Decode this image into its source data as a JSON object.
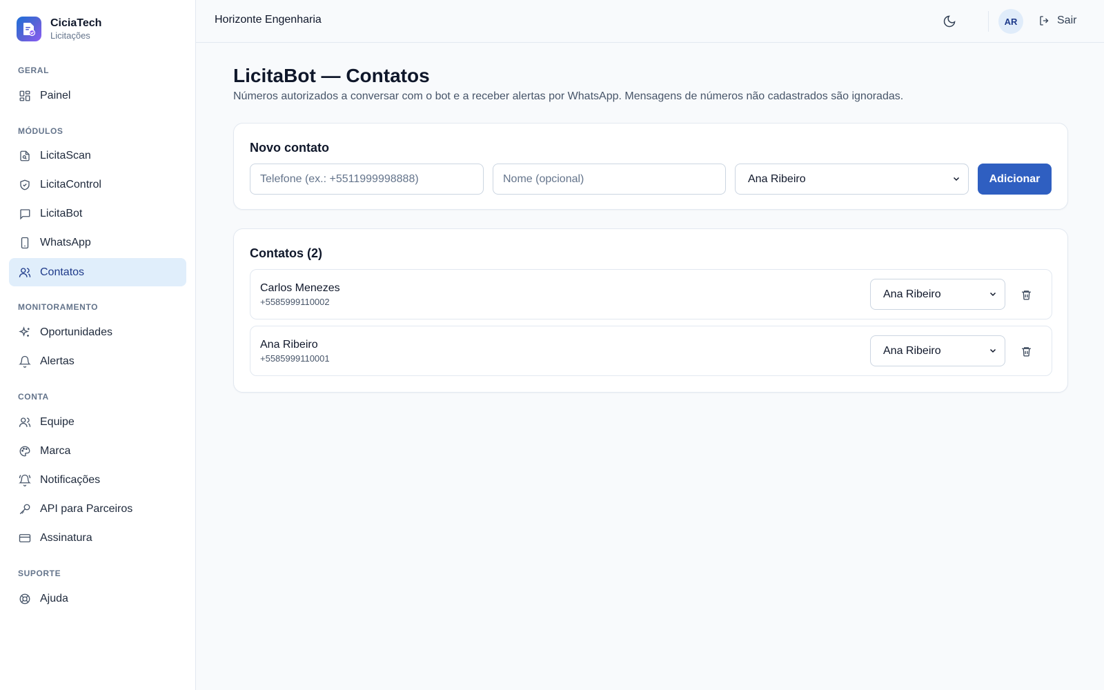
{
  "brand": {
    "name": "CiciaTech",
    "subtitle": "Licitações",
    "accent": "#2f5fc1"
  },
  "sidebar": {
    "sections": [
      {
        "title": "GERAL",
        "items": [
          {
            "label": "Painel",
            "icon": "grid-icon"
          }
        ]
      },
      {
        "title": "MÓDULOS",
        "items": [
          {
            "label": "LicitaScan",
            "icon": "file-scan-icon"
          },
          {
            "label": "LicitaControl",
            "icon": "shield-check-icon"
          },
          {
            "label": "LicitaBot",
            "icon": "message-square-icon"
          },
          {
            "label": "WhatsApp",
            "icon": "smartphone-icon"
          },
          {
            "label": "Contatos",
            "icon": "users-icon",
            "active": true
          }
        ]
      },
      {
        "title": "MONITORAMENTO",
        "items": [
          {
            "label": "Oportunidades",
            "icon": "sparkles-icon"
          },
          {
            "label": "Alertas",
            "icon": "bell-icon"
          }
        ]
      },
      {
        "title": "CONTA",
        "items": [
          {
            "label": "Equipe",
            "icon": "users-icon"
          },
          {
            "label": "Marca",
            "icon": "palette-icon"
          },
          {
            "label": "Notificações",
            "icon": "bell-ring-icon"
          },
          {
            "label": "API para Parceiros",
            "icon": "key-icon"
          },
          {
            "label": "Assinatura",
            "icon": "credit-card-icon"
          }
        ]
      },
      {
        "title": "SUPORTE",
        "items": [
          {
            "label": "Ajuda",
            "icon": "life-buoy-icon"
          }
        ]
      }
    ]
  },
  "header": {
    "org_name": "Horizonte Engenharia",
    "avatar_initials": "AR",
    "logout_label": "Sair"
  },
  "main": {
    "title": "LicitaBot — Contatos",
    "description": "Números autorizados a conversar com o bot e a receber alertas por WhatsApp. Mensagens de números não cadastrados são ignoradas.",
    "new_contact": {
      "title": "Novo contato",
      "phone_placeholder": "Telefone (ex.: +5511999998888)",
      "phone_value": "",
      "name_placeholder": "Nome (opcional)",
      "name_value": "",
      "owner_selected": "Ana Ribeiro",
      "add_label": "Adicionar"
    },
    "contacts": {
      "title": "Contatos (2)",
      "items": [
        {
          "name": "Carlos Menezes",
          "phone": "+5585999110002",
          "owner": "Ana Ribeiro"
        },
        {
          "name": "Ana Ribeiro",
          "phone": "+5585999110001",
          "owner": "Ana Ribeiro"
        }
      ]
    }
  }
}
